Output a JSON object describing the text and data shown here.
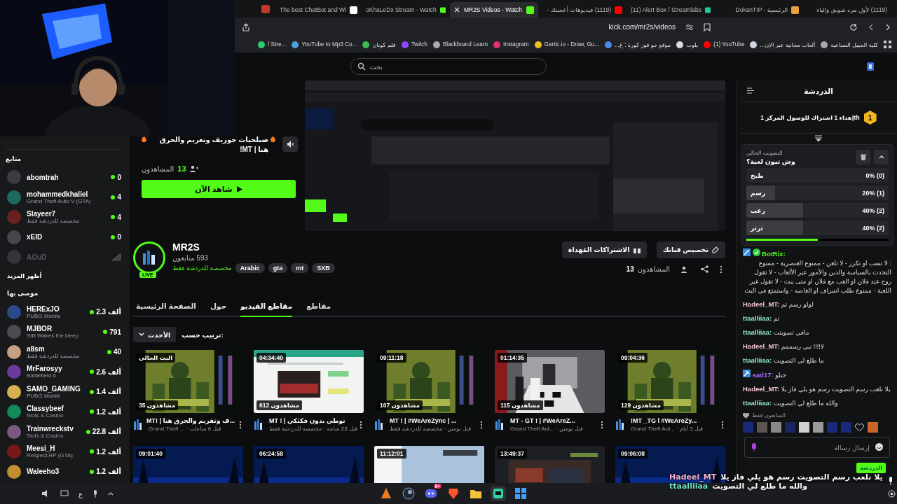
{
  "browser": {
    "tabs": [
      {
        "label": "(1119) لأول مره شونق وإلياء",
        "selected": false
      },
      {
        "label": "DokanTIP - الرئيسية",
        "selected": false
      },
      {
        "label": "(11) Alert Box / Streamlabs",
        "selected": false
      },
      {
        "label": "(1119) فيديوهات أعجبتك -",
        "selected": false
      },
      {
        "label": "MR2S Videos - Watch",
        "selected": true
      },
      {
        "label": "oKhaLeDx Stream - Watch",
        "selected": false
      },
      {
        "label": "The best ChatBot and Wi",
        "selected": false
      }
    ],
    "url": "kick.com/mr2s/videos",
    "bookmarks": [
      "كلية الجبيل الصناعية",
      "ألعاب مجانية عبر الإن...",
      "(1) YouTube",
      "بلوت",
      "موقع جو فور كورة : ع...",
      "Gartic.io - Draw, Gu...",
      "Instagram",
      "Blackboard Learn",
      "Twitch",
      "فلم كونان",
      "YouTube to Mp3 Co...",
      "/ Stre..."
    ]
  },
  "search": {
    "placeholder": "بحث"
  },
  "sidebar": {
    "following_title": "متابع",
    "following": [
      {
        "name": "abomtrah",
        "count": "0",
        "live": true
      },
      {
        "name": "mohammedkhaliel",
        "subtitle": "Grand Theft Auto V (GTA)",
        "count": "4",
        "live": true
      },
      {
        "name": "Slayeer7",
        "subtitle": "مخصصة للدردشة فقط",
        "count": "4",
        "live": true
      },
      {
        "name": "xEID",
        "count": "0",
        "live": true
      },
      {
        "name": "AOuD",
        "live": false
      }
    ],
    "show_more": "أظهر المزيد",
    "recommended_title": "موصى بها",
    "recommended": [
      {
        "name": "HERExJO",
        "subtitle": "PUBG Mobile",
        "count": "2.3 ألف"
      },
      {
        "name": "MJBOR",
        "subtitle": "Still Wakes the Deep",
        "count": "791"
      },
      {
        "name": "a8sm",
        "subtitle": "مخصصة للدردشة فقط",
        "count": "40"
      },
      {
        "name": "MrFarosyy",
        "subtitle": "Battlefield 6",
        "count": "2.6 ألف"
      },
      {
        "name": "SAMO_GAMING",
        "subtitle": "PUBG Mobile",
        "count": "1.4 ألف"
      },
      {
        "name": "Classybeef",
        "subtitle": "Slots & Casino",
        "count": "1.2 ألف"
      },
      {
        "name": "Trainwreckstv",
        "subtitle": "Slots & Casino",
        "count": "22.8 ألف"
      },
      {
        "name": "Meesi_H",
        "subtitle": "Respect RP (GTA)",
        "count": "1.2 ألف"
      },
      {
        "name": "Waleeho3",
        "count": "1.2 ألف"
      }
    ]
  },
  "preview": {
    "title": "صبلحيات جوزيف وتعريم والحرق هنا | MT!",
    "viewers": "13",
    "viewers_label": "المشاهدون",
    "watch": "شاهد الآن"
  },
  "channel": {
    "name": "MR2S",
    "live_badge": "LIVE",
    "followers": "593 متابعون",
    "category": "مخصصة للدردشة فقط",
    "tags": [
      "SXB",
      "mt",
      "gta",
      "Arabic"
    ],
    "actions": [
      "تخصيص قناتك",
      "الاشتراكات المُهداة"
    ],
    "viewers": "13",
    "viewers_label": "المشاهدون"
  },
  "tabs": [
    {
      "label": "مقاطع",
      "selected": false
    },
    {
      "label": "مقاطع الفيديو",
      "selected": true
    },
    {
      "label": "حول",
      "selected": false
    },
    {
      "label": "الصفحة الرئيسية",
      "selected": false
    }
  ],
  "sort": {
    "label": "ترتيب حسب:",
    "value": "الأحدث"
  },
  "videos": [
    {
      "duration": "09:04:36",
      "views": "129 مشاهدون",
      "title": "!MT _TG l #WeAreZy...",
      "meta": "Grand Theft Aut... · قبل 3 أيام"
    },
    {
      "duration": "01:14:35",
      "views": "115 مشاهدون",
      "title": "MT - GT ! | #WeAreZ...",
      "meta": "Grand Theft Aut... · قبل يومين"
    },
    {
      "duration": "09:11:18",
      "views": "107 مشاهدون",
      "title": "MT ! | #WeAreZync | ...",
      "meta": "قبل يومين · مخصصة للدردشة فقط"
    },
    {
      "duration": "04:34:40",
      "views": "612 مشاهدون",
      "title": "MT ! | نوطي بدون فكثكي",
      "meta": "قبل 23 ساعة · مخصصة للدردشة فقط"
    },
    {
      "duration": "البث الحالي",
      "views": "35 مشاهدون",
      "title": "...ف وتقريم والحرق هنا | !MT",
      "meta": "Grand Theft ... · قبل 6 ساعات"
    },
    {
      "duration": "09:06:08"
    },
    {
      "duration": "13:49:37"
    },
    {
      "duration": "11:12:01"
    },
    {
      "duration": "06:24:58"
    },
    {
      "duration": "09:01:40"
    }
  ],
  "chat": {
    "title": "الدردشة",
    "pinned": {
      "rank": "1",
      "text": "إهداء 1 اشتراك للوصول المركز 1th"
    },
    "poll": {
      "label": "التصويت الحالي",
      "question": "وش تبون لعبة؟",
      "options": [
        {
          "label": "طبخ",
          "result": "0% (0)",
          "level": 0
        },
        {
          "label": "رسم",
          "result": "20% (1)",
          "level": 0.2
        },
        {
          "label": "رعب",
          "result": "40% (2)",
          "level": 0.4
        },
        {
          "label": "ثرثر",
          "result": "40% (2)",
          "level": 0.4
        }
      ],
      "level": 0.5
    },
    "messages": [
      {
        "kind": "bot",
        "user": "BotRix:",
        "color": "#53fc18",
        "text": ": لا تسب او تكرر - لا تلعن - ممنوع العنصرية - ممنوع التحدث بالسياسة والدين والأمور عير الألعاب - لا تقول روح عند فلان او العب مع فلان او متى يبث - لا تقول غير اللعبة - ممنوع طلب اشراف او العاصه - واستمتع في البث"
      },
      {
        "kind": "user",
        "user": "Hadeel_MT:",
        "color": "#f3c1d3",
        "text": "لولو رسم تم"
      },
      {
        "kind": "user",
        "user": "ttaalliiaa:",
        "color": "#8fe8c9",
        "text": "تم"
      },
      {
        "kind": "user",
        "user": "ttaalliiaa:",
        "color": "#8fe8c9",
        "text": "مافي تصويتت"
      },
      {
        "kind": "user",
        "user": "Hadeel_MT:",
        "color": "#f3c1d3",
        "text": "لا!!!! نبي رسممم"
      },
      {
        "kind": "user",
        "user": "ttaalliiaa:",
        "color": "#8fe8c9",
        "text": "ما طلع لي التصويت"
      },
      {
        "kind": "mod",
        "user": "sad17:",
        "color": "#a970ff",
        "text": "حنلو"
      },
      {
        "kind": "user",
        "user": "Hadeel_MT:",
        "color": "#f3c1d3",
        "text": "يلا نلعب رسم التصويت رسم هو يلي فاز يلا"
      },
      {
        "kind": "user",
        "user": "ttaalliiaa:",
        "color": "#8fe8c9",
        "text": "والله ما طلع لي التصويت"
      }
    ],
    "followers_only": "المتابعون فقط",
    "input_placeholder": "إرسال رسالة"
  },
  "overlay": {
    "badge": "الدردشة",
    "lines": [
      {
        "user": "Hadeel_MT",
        "color": "#f7b2d0",
        "text": "يلا نلعب رسم التصويت رسم هو يلي فاز يلا"
      },
      {
        "user": "ttaalliiaa",
        "color": "#6ee7c7",
        "text": "والله ما طلع لي التصويت"
      }
    ]
  },
  "taskbar": {
    "tray": "ع",
    "notifications": "9+"
  }
}
